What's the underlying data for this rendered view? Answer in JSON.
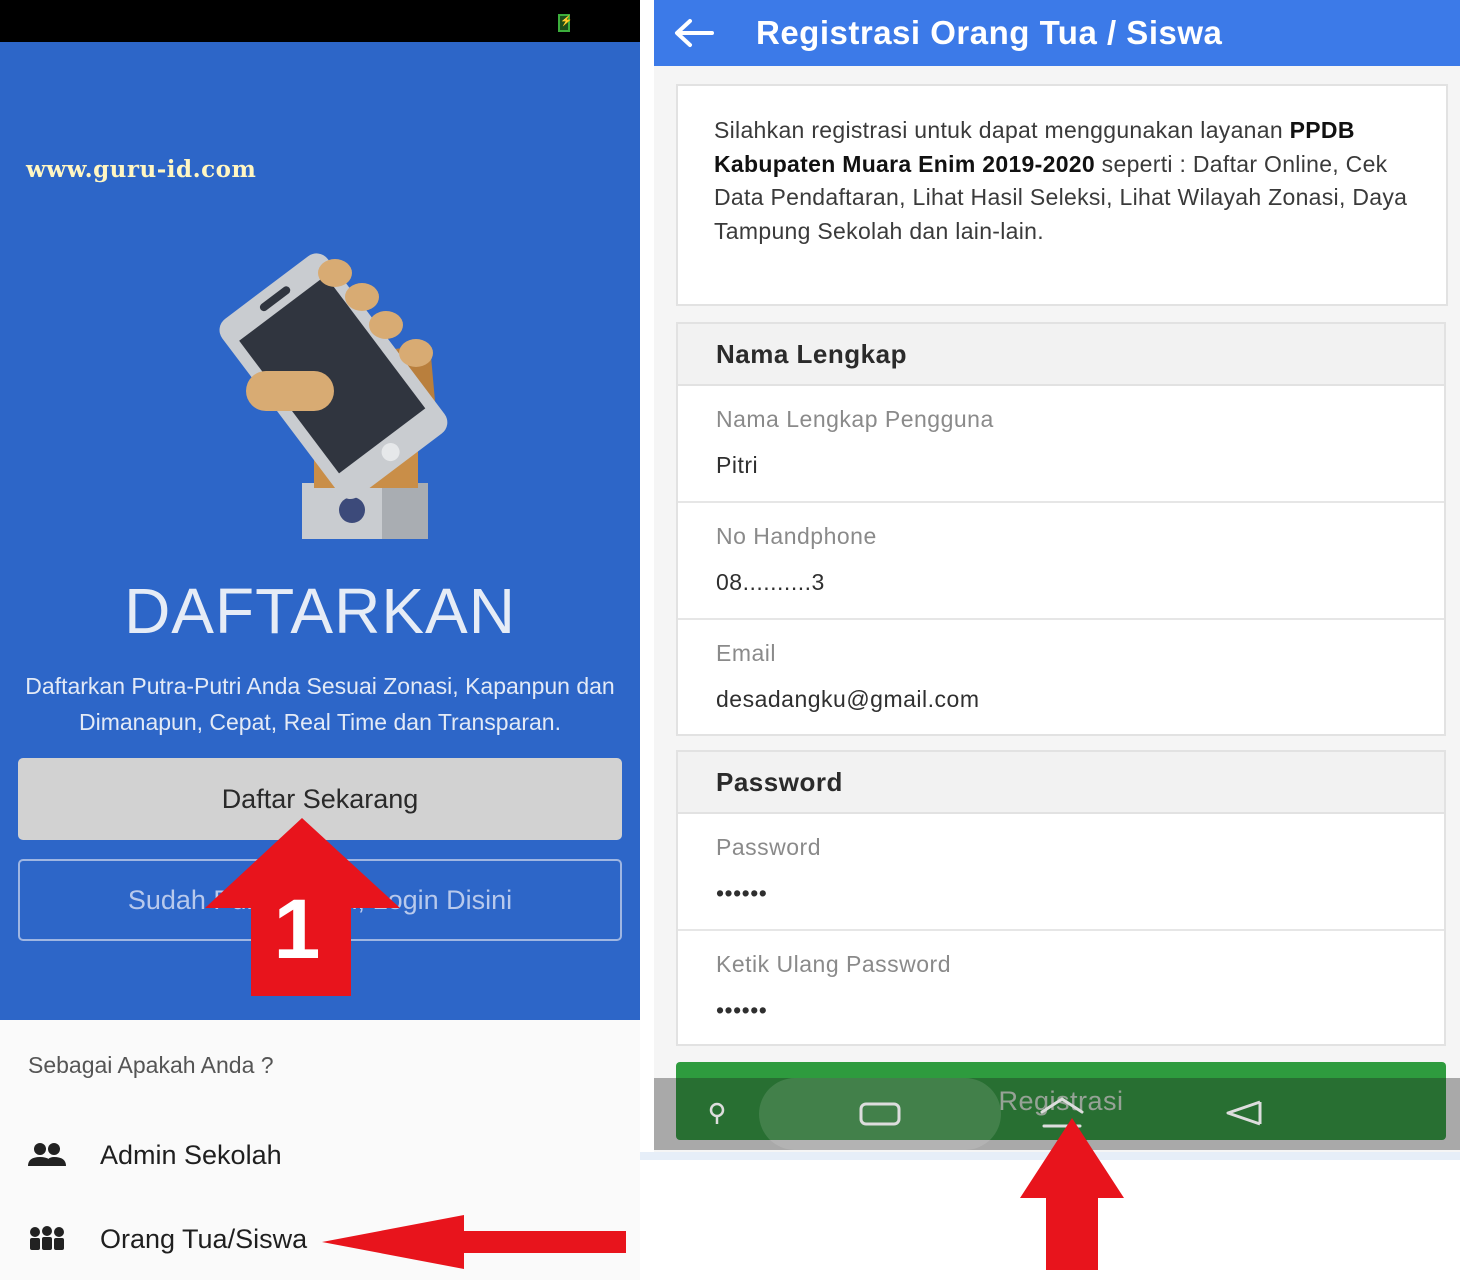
{
  "left": {
    "watermark": "www.guru-id.com",
    "hero_title": "DAFTARKAN",
    "hero_description": "Daftarkan Putra-Putri Anda Sesuai Zonasi, Kapanpun dan Dimanapun, Cepat, Real Time dan Transparan.",
    "register_button": "Daftar Sekarang",
    "login_button": "Sudah Punya Akun, Login Disini",
    "sheet_question": "Sebagai Apakah Anda ?",
    "roles": [
      {
        "label": "Admin Sekolah",
        "icon": "group-icon"
      },
      {
        "label": "Orang Tua/Siswa",
        "icon": "family-icon"
      }
    ],
    "annotation_number": "1"
  },
  "right": {
    "appbar_title": "Registrasi Orang Tua / Siswa",
    "intro": {
      "before": "Silahkan registrasi untuk dapat menggunakan layanan ",
      "bold": "PPDB Kabupaten Muara Enim 2019-2020",
      "after": " seperti : Daftar Online, Cek Data Pendaftaran, Lihat Hasil Seleksi, Lihat Wilayah Zonasi, Daya Tampung Sekolah dan lain-lain."
    },
    "section_profile": "Nama Lengkap",
    "fields_profile": [
      {
        "label": "Nama Lengkap Pengguna",
        "value": "Pitri"
      },
      {
        "label": "No Handphone",
        "value": "08..........3"
      },
      {
        "label": "Email",
        "value": "desadangku@gmail.com"
      }
    ],
    "section_password": "Password",
    "fields_password": [
      {
        "label": "Password",
        "value": "••••••"
      },
      {
        "label": "Ketik Ulang Password",
        "value": "••••••"
      }
    ],
    "register_button": "Registrasi"
  },
  "colors": {
    "primary_blue": "#2d66c8",
    "appbar_blue": "#3c7ae8",
    "success_green": "#2e9b3e",
    "annotation_red": "#e8141c"
  }
}
